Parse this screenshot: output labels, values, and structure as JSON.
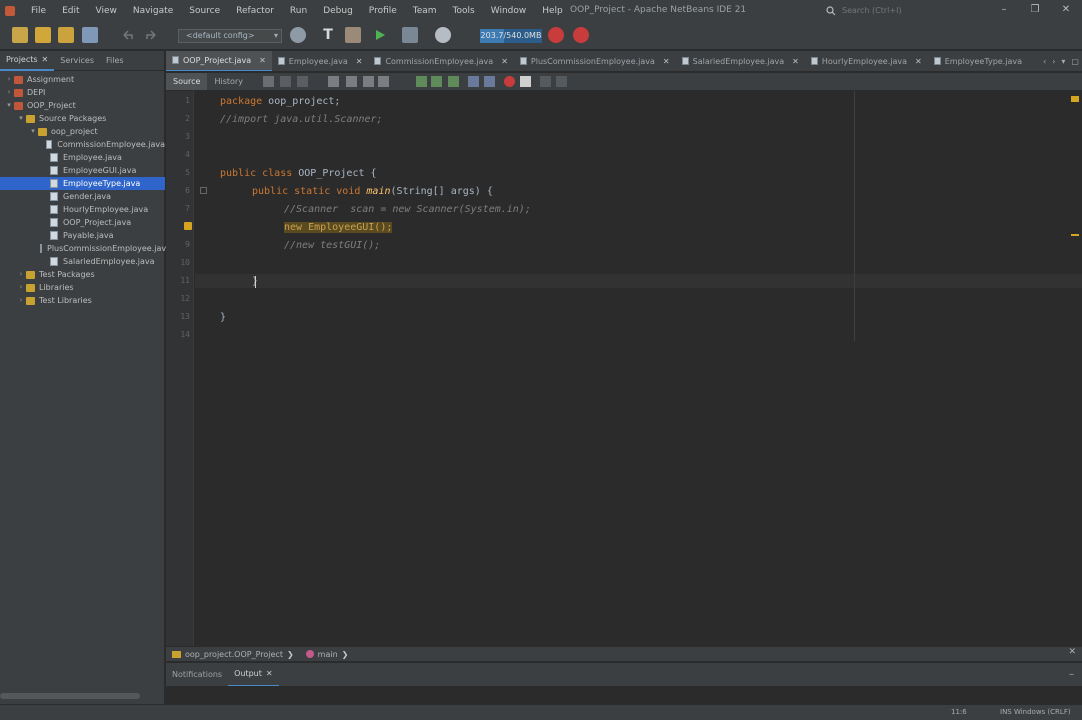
{
  "window": {
    "title": "OOP_Project - Apache NetBeans IDE 21",
    "menu": [
      "File",
      "Edit",
      "View",
      "Navigate",
      "Source",
      "Refactor",
      "Run",
      "Debug",
      "Profile",
      "Team",
      "Tools",
      "Window",
      "Help"
    ],
    "search_placeholder": "Search (Ctrl+I)",
    "controls": {
      "minimize": "–",
      "restore": "❐",
      "close": "✕"
    }
  },
  "toolbar": {
    "config": "<default config>",
    "memory": "203.7/540.0MB",
    "memory_fraction": 0.38
  },
  "left_panel": {
    "tabs": [
      {
        "label": "Projects",
        "active": true,
        "closable": true
      },
      {
        "label": "Services",
        "active": false,
        "closable": false
      },
      {
        "label": "Files",
        "active": false,
        "closable": false
      }
    ],
    "tree": [
      {
        "label": "Assignment",
        "kind": "project",
        "depth": 0,
        "expanded": false
      },
      {
        "label": "DEPI",
        "kind": "project",
        "depth": 0,
        "expanded": false
      },
      {
        "label": "OOP_Project",
        "kind": "project",
        "depth": 0,
        "expanded": true
      },
      {
        "label": "Source Packages",
        "kind": "package",
        "depth": 1,
        "expanded": true
      },
      {
        "label": "oop_project",
        "kind": "package",
        "depth": 2,
        "expanded": true
      },
      {
        "label": "CommissionEmployee.java",
        "kind": "java",
        "depth": 3
      },
      {
        "label": "Employee.java",
        "kind": "java",
        "depth": 3
      },
      {
        "label": "EmployeeGUI.java",
        "kind": "java",
        "depth": 3
      },
      {
        "label": "EmployeeType.java",
        "kind": "java",
        "depth": 3,
        "selected": true
      },
      {
        "label": "Gender.java",
        "kind": "java",
        "depth": 3
      },
      {
        "label": "HourlyEmployee.java",
        "kind": "java",
        "depth": 3
      },
      {
        "label": "OOP_Project.java",
        "kind": "java",
        "depth": 3
      },
      {
        "label": "Payable.java",
        "kind": "java",
        "depth": 3
      },
      {
        "label": "PlusCommissionEmployee.java",
        "kind": "java",
        "depth": 3
      },
      {
        "label": "SalariedEmployee.java",
        "kind": "java",
        "depth": 3
      },
      {
        "label": "Test Packages",
        "kind": "package",
        "depth": 1,
        "expanded": false
      },
      {
        "label": "Libraries",
        "kind": "package",
        "depth": 1,
        "expanded": false
      },
      {
        "label": "Test Libraries",
        "kind": "package",
        "depth": 1,
        "expanded": false
      }
    ]
  },
  "editor_tabs": [
    {
      "label": "OOP_Project.java",
      "active": true
    },
    {
      "label": "Employee.java",
      "active": false
    },
    {
      "label": "CommissionEmployee.java",
      "active": false
    },
    {
      "label": "PlusCommissionEmployee.java",
      "active": false
    },
    {
      "label": "SalariedEmployee.java",
      "active": false
    },
    {
      "label": "HourlyEmployee.java",
      "active": false
    },
    {
      "label": "EmployeeType.java",
      "active": false
    }
  ],
  "editor_subtabs": [
    "Source",
    "History"
  ],
  "code": {
    "line_numbers": [
      "1",
      "2",
      "3",
      "4",
      "5",
      "6",
      "7",
      "8",
      "9",
      "10",
      "11",
      "12",
      "13",
      "14"
    ],
    "lines": {
      "l1_kw": "package",
      "l1_rest": " oop_project;",
      "l2": "//import java.util.Scanner;",
      "l5_kw": "public class",
      "l5_rest": " OOP_Project {",
      "l6_kw": "public static void",
      "l6_fn": "main",
      "l6_rest": "(String[] args) {",
      "l7": "//Scanner  scan = new Scanner(System.in);",
      "l8": "new EmployeeGUI();",
      "l9": "//new testGUI();",
      "l11": "}",
      "l13": "}"
    }
  },
  "breadcrumb": {
    "class_path": "oop_project.OOP_Project",
    "method": "main"
  },
  "bottom_tabs": [
    {
      "label": "Notifications",
      "active": false
    },
    {
      "label": "Output",
      "active": true
    }
  ],
  "status": {
    "position": "11:6",
    "mode": "INS Windows (CRLF)"
  }
}
